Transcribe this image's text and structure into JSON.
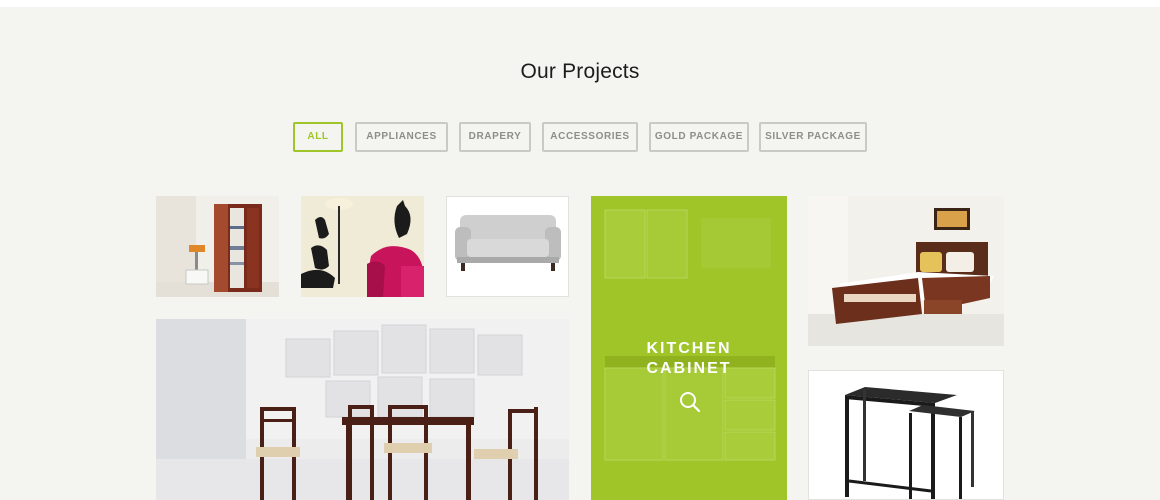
{
  "section": {
    "title": "Our Projects"
  },
  "filters": [
    "ALL",
    "APPLIANCES",
    "DRAPERY",
    "ACCESSORIES",
    "GOLD PACKAGE",
    "SILVER PACKAGE"
  ],
  "active_filter": "ALL",
  "featured": {
    "line1": "KITCHEN",
    "line2": "CABINET",
    "icon": "search-icon"
  },
  "colors": {
    "accent": "#9fc528",
    "background": "#f4f4f0",
    "border": "#c9c9c6"
  }
}
